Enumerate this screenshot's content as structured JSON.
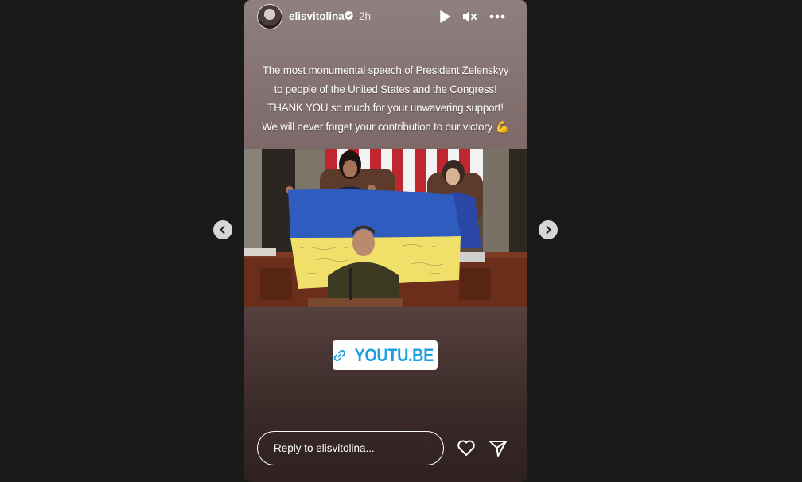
{
  "story": {
    "username": "elisvitolina",
    "time_ago": "2h",
    "caption_lines": [
      "The most monumental speech of President Zelenskyy",
      "to people of the United States and the Congress!",
      "THANK YOU  so much for your unwavering support!",
      "We will never forget your contribution to our victory"
    ],
    "caption_emoji": "💪",
    "link_sticker_text": "YOUTU.BE",
    "reply_placeholder": "Reply to elisvitolina..."
  },
  "icons": {
    "verified": "verified-badge-icon",
    "play": "play-icon",
    "mute": "muted-speaker-icon",
    "more": "more-options-icon",
    "link": "link-icon",
    "like": "heart-icon",
    "share": "send-icon",
    "prev": "chevron-left-icon",
    "next": "chevron-right-icon"
  },
  "colors": {
    "page_background": "#1a1a1a",
    "link_text": "#1fa0df",
    "flag_blue": "#2f5dbf",
    "flag_yellow": "#f0e06a"
  }
}
